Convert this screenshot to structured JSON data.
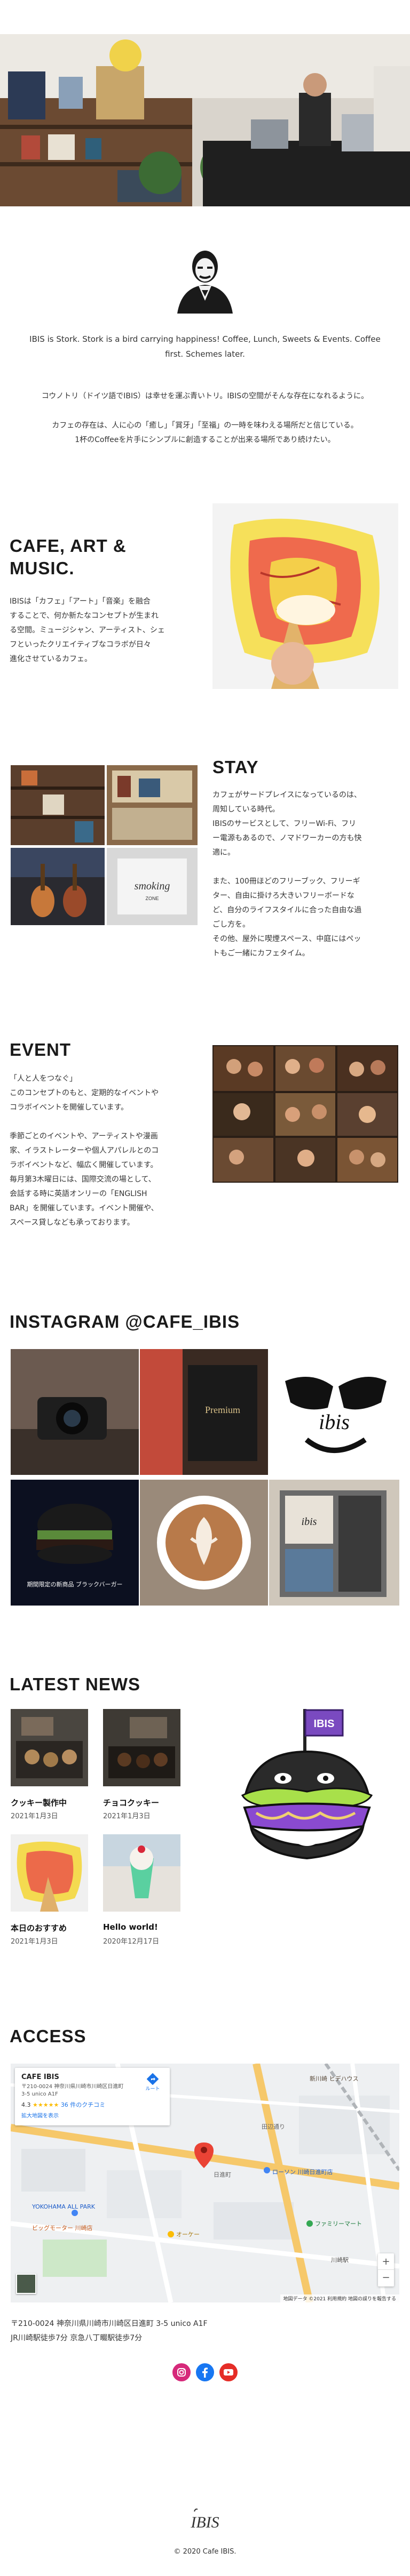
{
  "intro": {
    "english": "IBIS is Stork. Stork is a bird carrying happiness! Coffee, Lunch, Sweets & Events. Coffee first. Schemes later.",
    "jp_line1": "コウノトリ（ドイツ語でIBIS）は幸せを運ぶ青いトリ。IBISの空間がそんな存在になれるように。",
    "jp_line2": "カフェの存在は、人に心の「癒し」「賞牙」「至福」の一時を味わえる場所だと信じている。",
    "jp_line3": "1杯のCoffeeを片手にシンプルに創造することが出来る場所であり続けたい。"
  },
  "cafe_art": {
    "heading_line1": "CAFE, ART &",
    "heading_line2": "MUSIC.",
    "body": [
      "IBISは「カフェ」「アート」「音楽」を融合",
      "することで、何か新たなコンセプトが生まれ",
      "る空間。ミュージシャン、アーティスト、シェ",
      "フといったクリエイティブなコラボが日々",
      "進化させているカフェ。"
    ]
  },
  "stay": {
    "heading": "STAY",
    "body": [
      "カフェがサードプレイスになっているのは、",
      "周知している時代。",
      "IBISのサービスとして、フリーWi-Fi、フリ",
      "ー電源もあるので、ノマドワーカーの方も快",
      "適に。",
      "",
      "また、100冊ほどのフリーブック、フリーギ",
      "ター、自由に掛けろ大きいフリーボードな",
      "ど、自分のライフスタイルに合った自由な過",
      "ごし方を。",
      "その他、屋外に喫煙スペース、中庭にはペッ",
      "トもご一緒にカフェタイム。"
    ]
  },
  "event": {
    "heading": "EVENT",
    "body": [
      "「人と人をつなぐ」",
      "このコンセプトのもと、定期的なイベントや",
      "コラボイベントを開催しています。",
      "",
      "季節ごとのイベントや、アーティストや漫画",
      "家、イラストレーターや個人アパレルとのコ",
      "ラボイベントなど、幅広く開催しています。",
      "毎月第3木曜日には、国際交流の場として、",
      "会話する時に英語オンリーの「ENGLISH",
      "BAR」を開催しています。イベント開催や、",
      "スペース貸しなども承っております。"
    ]
  },
  "instagram": {
    "heading": "INSTAGRAM @CAFE_IBIS",
    "tiles": [
      {
        "icon": "camera-photo-icon",
        "caption": ""
      },
      {
        "icon": "coffee-bag-photo-icon",
        "caption": "Premium"
      },
      {
        "icon": "ibis-logo-art-icon",
        "caption": "ibis"
      },
      {
        "icon": "black-burger-photo-icon",
        "caption": "期間限定の新商品 ブラックバーガー"
      },
      {
        "icon": "latte-art-photo-icon",
        "caption": ""
      },
      {
        "icon": "shop-window-photo-icon",
        "caption": "ibis"
      }
    ]
  },
  "news": {
    "heading": "LATEST NEWS",
    "items": [
      {
        "title": "クッキー製作中",
        "date": "2021年1月3日"
      },
      {
        "title": "チョコクッキー",
        "date": "2021年1月3日"
      },
      {
        "title": "本日のおすすめ",
        "date": "2021年1月3日"
      },
      {
        "title": "Hello world!",
        "date": "2020年12月17日"
      }
    ],
    "mascot_flag": "IBIS"
  },
  "access": {
    "heading": "ACCESS",
    "map": {
      "place_name": "CAFE IBIS",
      "place_address": "〒210-0024 神奈川県川崎市川崎区日進町 3-5 unico A1F",
      "rating": "4.3",
      "stars": "★★★★★",
      "reviews": "36 件のクチコミ",
      "directions_label": "ルート",
      "larger_map": "拡大地図を表示",
      "zoom_in": "+",
      "zoom_out": "−",
      "footer_note": "地図データ ©2021  利用規約  地図の誤りを報告する",
      "labels": [
        "新川崎 ヒデハウス",
        "田辺通り",
        "日進町",
        "ローソン 川崎日進町店",
        "YOKOHAMA ALL PARK",
        "ビッグモーター 川崎店",
        "ファミリーマート",
        "オーケー",
        "川崎駅"
      ]
    },
    "address_line1": "〒210-0024 神奈川県川崎市川崎区日進町 3-5 unico A1F",
    "address_line2": "JR川崎駅徒歩7分 京急八丁畷駅徒歩7分"
  },
  "social": {
    "icons": [
      "instagram-icon",
      "facebook-icon",
      "youtube-icon"
    ]
  },
  "footer": {
    "logo_text": "IBIS",
    "copyright": "© 2020 Cafe IBIS."
  },
  "colors": {
    "instagram": "#d6297a",
    "facebook": "#1877f2",
    "youtube": "#e52d27",
    "mascot_purple": "#6a3fb0",
    "map_road": "#f6c86a",
    "map_bg": "#eef0f2"
  }
}
